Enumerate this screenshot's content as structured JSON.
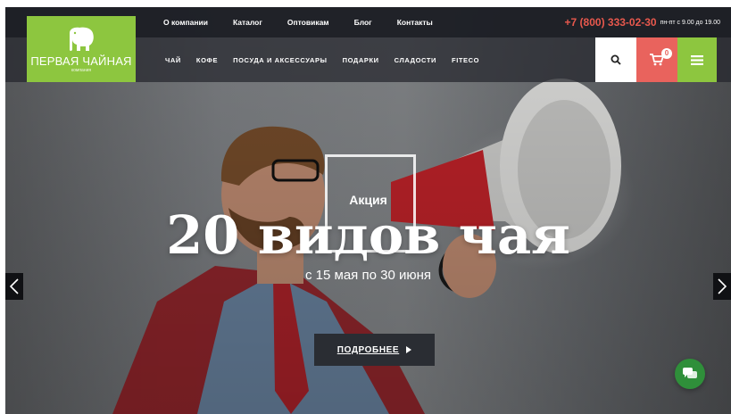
{
  "topbar": {
    "nav": [
      "О компании",
      "Каталог",
      "Оптовикам",
      "Блог",
      "Контакты"
    ],
    "phone": "+7 (800) 333-02-30",
    "hours": "пн-пт с 9.00 до 19.00"
  },
  "logo": {
    "name": "ПЕРВАЯ ЧАЙНАЯ",
    "sub": "компания"
  },
  "mainnav": [
    "ЧАЙ",
    "КОФЕ",
    "ПОСУДА И АКСЕССУАРЫ",
    "ПОДАРКИ",
    "СЛАДОСТИ",
    "FITECO"
  ],
  "cart": {
    "count": "0"
  },
  "icons": {
    "search": "search-icon",
    "cart": "cart-icon",
    "menu": "hamburger-icon",
    "prev": "chevron-left-icon",
    "next": "chevron-right-icon",
    "chat": "chat-icon"
  },
  "colors": {
    "accent_green": "#8dc63f",
    "accent_red": "#e9635d",
    "phone": "#e8584d",
    "chat": "#2f8f3a"
  },
  "slide": {
    "label": "Акция",
    "title": "20 видов чая",
    "dates": "с 15 мая по 30 июня",
    "button": "ПОДРОБНЕЕ"
  }
}
